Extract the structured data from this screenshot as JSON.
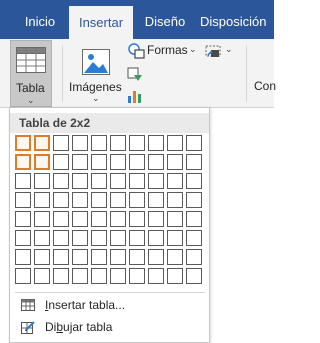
{
  "tabs": {
    "inicio": "Inicio",
    "insertar": "Insertar",
    "diseno": "Diseño",
    "disposicion": "Disposición"
  },
  "ribbon": {
    "tabla_label": "Tabla",
    "imagenes_label": "Imágenes",
    "formas_label": "Formas",
    "truncated_label": "Con"
  },
  "menu": {
    "header": "Tabla de 2x2",
    "grid_columns": 10,
    "grid_rows": 8,
    "selected_columns": 2,
    "selected_rows": 2,
    "insert_table": {
      "pre": "",
      "key": "I",
      "post": "nsertar tabla..."
    },
    "draw_table": {
      "pre": "Di",
      "key": "b",
      "post": "ujar tabla"
    }
  },
  "colors": {
    "tabbar": "#2b579a",
    "ribbon": "#f3f3f3",
    "selection": "#e07b27"
  }
}
